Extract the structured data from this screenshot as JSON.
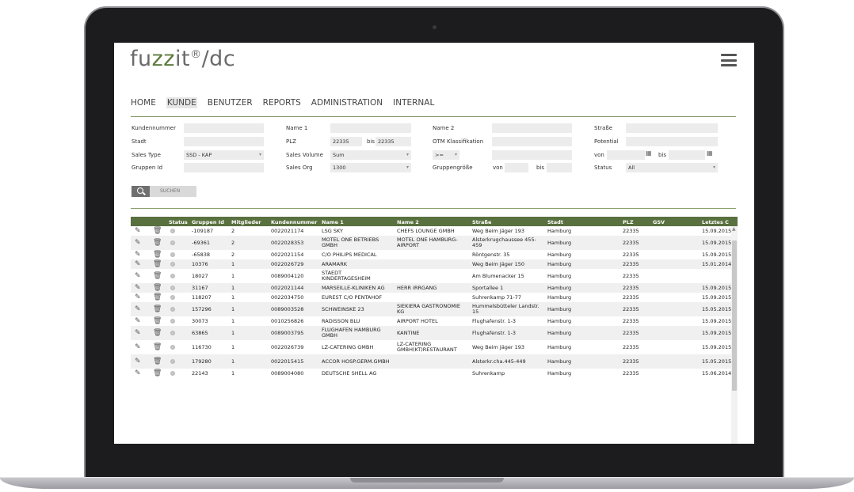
{
  "app": {
    "logo_main": "fuzzit",
    "logo_reg": "®",
    "logo_suffix": "/dc"
  },
  "nav": [
    {
      "label": "HOME",
      "active": false
    },
    {
      "label": "KUNDE",
      "active": true
    },
    {
      "label": "BENUTZER",
      "active": false
    },
    {
      "label": "REPORTS",
      "active": false
    },
    {
      "label": "ADMINISTRATION",
      "active": false
    },
    {
      "label": "INTERNAL",
      "active": false
    }
  ],
  "filters": {
    "kundennummer_label": "Kundennummer",
    "kundennummer_value": "",
    "stadt_label": "Stadt",
    "stadt_value": "",
    "salestype_label": "Sales Type",
    "salestype_value": "SSD - KAP",
    "gruppenid_label": "Gruppen Id",
    "gruppenid_value": "",
    "name1_label": "Name 1",
    "name1_value": "",
    "plz_label": "PLZ",
    "plz_from": "22335",
    "plz_bis_label": "bis",
    "plz_to": "22335",
    "salesvolume_label": "Sales Volume",
    "salesvolume_value": "Sum",
    "salesorg_label": "Sales Org",
    "salesorg_value": "1300",
    "name2_label": "Name 2",
    "name2_value": "",
    "otm_label": "OTM Klassifikation",
    "otm_value": "",
    "compare_value": ">=",
    "gruppengroesse_label": "Gruppengröße",
    "von_label": "von",
    "bis_label": "bis",
    "strasse_label": "Straße",
    "strasse_value": "",
    "potential_label": "Potential",
    "potential_value": "",
    "pot_von_label": "von",
    "pot_bis_label": "bis",
    "status_label": "Status",
    "status_value": "All"
  },
  "search_button": "SUCHEN",
  "table": {
    "headers": [
      "Status",
      "Gruppen Id",
      "Mitglieder",
      "Kundennummer",
      "Name 1",
      "Name 2",
      "Straße",
      "Stadt",
      "PLZ",
      "GSV",
      "Letztes C"
    ],
    "rows": [
      {
        "gid": "-109187",
        "mit": "2",
        "kn": "0022021174",
        "n1": "LSG SKY",
        "n2": "CHEFS LOUNGE GMBH",
        "str": "Weg Beim Jäger 193",
        "stadt": "Hamburg",
        "plz": "22335",
        "gsv": "",
        "date": "15.09.2015"
      },
      {
        "gid": "-69361",
        "mit": "2",
        "kn": "0022028353",
        "n1": "MOTEL ONE BETRIEBS GMBH",
        "n2": "MOTEL ONE HAMBURG-AIRPORT",
        "str": "Alsterkrugchaussee 455-459",
        "stadt": "Hamburg",
        "plz": "22335",
        "gsv": "",
        "date": "15.09.2015"
      },
      {
        "gid": "-65838",
        "mit": "2",
        "kn": "0022021154",
        "n1": "C/O PHILIPS MEDICAL",
        "n2": "",
        "str": "Röntgenstr. 35",
        "stadt": "Hamburg",
        "plz": "22335",
        "gsv": "",
        "date": "15.09.2015"
      },
      {
        "gid": "10376",
        "mit": "1",
        "kn": "0022026729",
        "n1": "ARAMARK",
        "n2": "",
        "str": "Weg Beim Jäger 150",
        "stadt": "Hamburg",
        "plz": "22335",
        "gsv": "",
        "date": "15.01.2014"
      },
      {
        "gid": "18027",
        "mit": "1",
        "kn": "0089004120",
        "n1": "STAEDT KINDERTAGESHEIM",
        "n2": "",
        "str": "Am Blumenacker 15",
        "stadt": "Hamburg",
        "plz": "22335",
        "gsv": "",
        "date": ""
      },
      {
        "gid": "31167",
        "mit": "1",
        "kn": "0022021144",
        "n1": "MARSEILLE-KLINIKEN AG",
        "n2": "HERR IRRGANG",
        "str": "Sportallee 1",
        "stadt": "Hamburg",
        "plz": "22335",
        "gsv": "",
        "date": "15.09.2015"
      },
      {
        "gid": "118207",
        "mit": "1",
        "kn": "0022034750",
        "n1": "EUREST C/O PENTAHOF",
        "n2": "",
        "str": "Suhrenkamp 71-77",
        "stadt": "Hamburg",
        "plz": "22335",
        "gsv": "",
        "date": "15.09.2015"
      },
      {
        "gid": "157296",
        "mit": "1",
        "kn": "0089003528",
        "n1": "SCHWEINSKE 23",
        "n2": "SIEKIERA GASTRONOMIE KG",
        "str": "Hummelsbütteler Landstr. 15",
        "stadt": "Hamburg",
        "plz": "22335",
        "gsv": "",
        "date": "15.05.2015"
      },
      {
        "gid": "30073",
        "mit": "1",
        "kn": "0010256826",
        "n1": "RADISSON BLU",
        "n2": "AIRPORT HOTEL",
        "str": "Flughafenstr. 1-3",
        "stadt": "Hamburg",
        "plz": "22335",
        "gsv": "",
        "date": "15.09.2015"
      },
      {
        "gid": "63865",
        "mit": "1",
        "kn": "0089003795",
        "n1": "FLUGHAFEN HAMBURG GMBH",
        "n2": "KANTINE",
        "str": "Flughafenstr. 1-3",
        "stadt": "Hamburg",
        "plz": "22335",
        "gsv": "",
        "date": "15.09.2015"
      },
      {
        "gid": "116730",
        "mit": "1",
        "kn": "0022026739",
        "n1": "LZ-CATERING GMBH",
        "n2": "LZ-CATERING GMBH(KT)RESTAURANT",
        "str": "Weg Beim Jäger 193",
        "stadt": "Hamburg",
        "plz": "22335",
        "gsv": "",
        "date": "15.09.2015"
      },
      {
        "gid": "179280",
        "mit": "1",
        "kn": "0022015415",
        "n1": "ACCOR HOSP.GERM.GMBH",
        "n2": "",
        "str": "Alsterkr.cha.445-449",
        "stadt": "Hamburg",
        "plz": "22335",
        "gsv": "",
        "date": "15.05.2015"
      },
      {
        "gid": "22143",
        "mit": "1",
        "kn": "0089004080",
        "n1": "DEUTSCHE SHELL AG",
        "n2": "",
        "str": "Suhrenkamp",
        "stadt": "Hamburg",
        "plz": "22335",
        "gsv": "",
        "date": "15.06.2014"
      }
    ]
  },
  "colors": {
    "accent": "#59703f",
    "logo_green": "#5b7a3c"
  },
  "icons": [
    "edit-icon",
    "trash-icon",
    "status-check-icon",
    "hamburger-menu-icon",
    "search-icon",
    "calendar-icon"
  ]
}
